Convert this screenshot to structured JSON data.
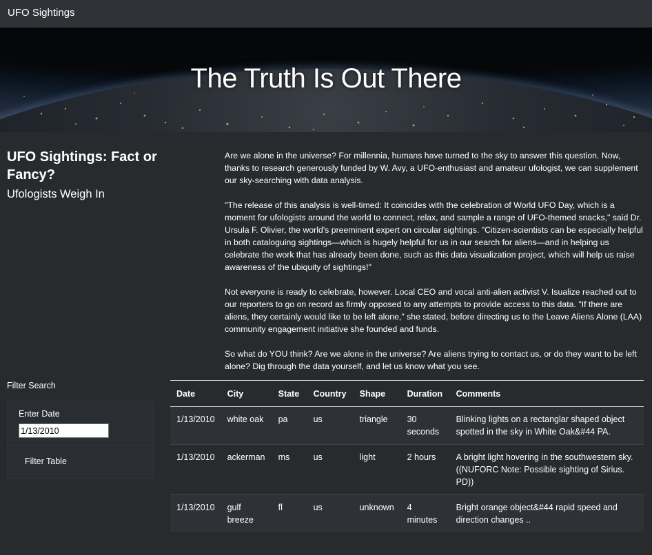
{
  "navbar": {
    "brand": "UFO Sightings"
  },
  "hero": {
    "title": "The Truth Is Out There"
  },
  "article": {
    "title": "UFO Sightings: Fact or Fancy?",
    "subtitle": "Ufologists Weigh In",
    "paragraphs": [
      "Are we alone in the universe? For millennia, humans have turned to the sky to answer this question. Now, thanks to research generously funded by W. Avy, a UFO-enthusiast and amateur ufologist, we can supplement our sky-searching with data analysis.",
      "\"The release of this analysis is well-timed: It coincides with the celebration of World UFO Day, which is a moment for ufologists around the world to connect, relax, and sample a range of UFO-themed snacks,\" said Dr. Ursula F. Olivier, the world's preeminent expert on circular sightings. \"Citizen-scientists can be especially helpful in both cataloguing sightings—which is hugely helpful for us in our search for aliens—and in helping us celebrate the work that has already been done, such as this data visualization project, which will help us raise awareness of the ubiquity of sightings!\"",
      "Not everyone is ready to celebrate, however. Local CEO and vocal anti-alien activist V. Isualize reached out to our reporters to go on record as firmly opposed to any attempts to provide access to this data. \"If there are aliens, they certainly would like to be left alone,\" she stated, before directing us to the Leave Aliens Alone (LAA) community engagement initiative she founded and funds.",
      "So what do YOU think? Are we alone in the universe? Are aliens trying to contact us, or do they want to be left alone? Dig through the data yourself, and let us know what you see."
    ]
  },
  "filter": {
    "heading": "Filter Search",
    "date_label": "Enter Date",
    "date_value": "1/13/2010",
    "button_label": "Filter Table"
  },
  "table": {
    "headers": [
      "Date",
      "City",
      "State",
      "Country",
      "Shape",
      "Duration",
      "Comments"
    ],
    "rows": [
      [
        "1/13/2010",
        "white oak",
        "pa",
        "us",
        "triangle",
        "30 seconds",
        "Blinking lights on a rectanglar shaped object spotted in the sky in White Oak&#44 PA."
      ],
      [
        "1/13/2010",
        "ackerman",
        "ms",
        "us",
        "light",
        "2 hours",
        "A bright light hovering in the southwestern sky. ((NUFORC Note: Possible sighting of Sirius. PD))"
      ],
      [
        "1/13/2010",
        "gulf breeze",
        "fl",
        "us",
        "unknown",
        "4 minutes",
        "Bright orange object&#44 rapid speed and direction changes .."
      ]
    ]
  }
}
